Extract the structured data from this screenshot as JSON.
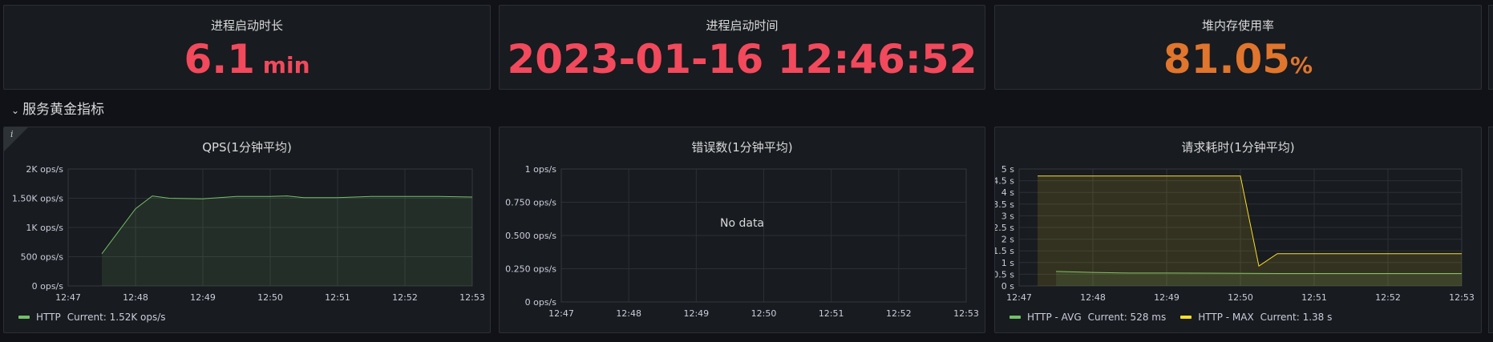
{
  "stats": [
    {
      "title": "进程启动时长",
      "value": "6.1",
      "unit": "min",
      "color": "#f2495c"
    },
    {
      "title": "进程启动时间",
      "value": "2023-01-16 12:46:52",
      "unit": "",
      "color": "#f2495c"
    },
    {
      "title": "堆内存使用率",
      "value": "81.05",
      "unit": "%",
      "color": "#e0752d"
    }
  ],
  "row": {
    "chevron": "⌄",
    "title": "服务黄金指标"
  },
  "info_icon": "i",
  "chart_data": [
    {
      "type": "area",
      "title": "QPS(1分钟平均)",
      "x_ticks": [
        "12:47",
        "12:48",
        "12:49",
        "12:50",
        "12:51",
        "12:52",
        "12:53"
      ],
      "y_ticks": [
        "0 ops/s",
        "500 ops/s",
        "1K ops/s",
        "1.50K ops/s",
        "2K ops/s"
      ],
      "ylim": [
        0,
        2000
      ],
      "xlim": [
        "12:47",
        "12:53"
      ],
      "grid": true,
      "series": [
        {
          "name": "HTTP",
          "color": "#73bf69",
          "x": [
            "12:47:30",
            "12:48:00",
            "12:48:15",
            "12:48:30",
            "12:49:00",
            "12:49:30",
            "12:50:00",
            "12:50:15",
            "12:50:30",
            "12:51:00",
            "12:51:30",
            "12:52:00",
            "12:52:30",
            "12:53:00"
          ],
          "values": [
            550,
            1320,
            1540,
            1500,
            1490,
            1530,
            1530,
            1540,
            1510,
            1510,
            1530,
            1530,
            1530,
            1520
          ]
        }
      ],
      "legend": [
        {
          "name": "HTTP",
          "current": "Current: 1.52K ops/s",
          "color": "#73bf69"
        }
      ]
    },
    {
      "type": "line",
      "title": "错误数(1分钟平均)",
      "x_ticks": [
        "12:47",
        "12:48",
        "12:49",
        "12:50",
        "12:51",
        "12:52",
        "12:53"
      ],
      "y_ticks": [
        "0 ops/s",
        "0.250 ops/s",
        "0.500 ops/s",
        "0.750 ops/s",
        "1 ops/s"
      ],
      "ylim": [
        0,
        1
      ],
      "grid": true,
      "nodata": "No data",
      "series": []
    },
    {
      "type": "area",
      "title": "请求耗时(1分钟平均)",
      "x_ticks": [
        "12:47",
        "12:48",
        "12:49",
        "12:50",
        "12:51",
        "12:52",
        "12:53"
      ],
      "y_ticks": [
        "0 s",
        "0.5 s",
        "1 s",
        "1.5 s",
        "2 s",
        "2.5 s",
        "3 s",
        "3.5 s",
        "4 s",
        "4.5 s",
        "5 s"
      ],
      "ylim": [
        0,
        5
      ],
      "grid": true,
      "series": [
        {
          "name": "HTTP - AVG",
          "color": "#73bf69",
          "x": [
            "12:47:30",
            "12:48:00",
            "12:48:30",
            "12:49:00",
            "12:50:00",
            "12:50:30",
            "12:51:00",
            "12:52:00",
            "12:53:00"
          ],
          "values": [
            0.62,
            0.58,
            0.55,
            0.55,
            0.54,
            0.53,
            0.53,
            0.53,
            0.53
          ]
        },
        {
          "name": "HTTP - MAX",
          "color": "#fade2a",
          "x": [
            "12:47:15",
            "12:50:00",
            "12:50:15",
            "12:50:30",
            "12:51:00",
            "12:52:00",
            "12:53:00"
          ],
          "values": [
            4.7,
            4.7,
            0.85,
            1.38,
            1.38,
            1.38,
            1.38
          ]
        }
      ],
      "legend": [
        {
          "name": "HTTP - AVG",
          "current": "Current: 528 ms",
          "color": "#73bf69"
        },
        {
          "name": "HTTP - MAX",
          "current": "Current: 1.38 s",
          "color": "#fade2a"
        }
      ]
    }
  ]
}
